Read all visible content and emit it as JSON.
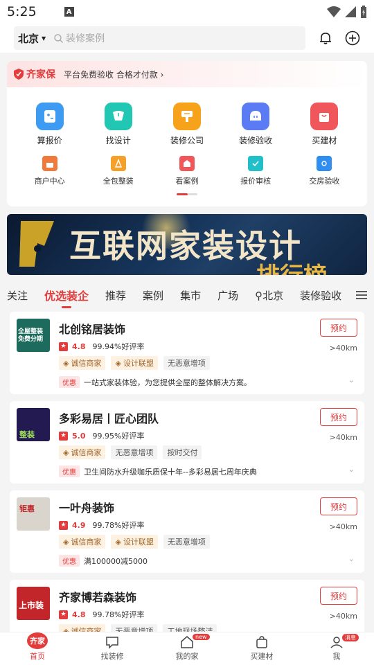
{
  "status": {
    "time": "5:25",
    "a_icon": "A"
  },
  "search": {
    "city": "北京",
    "placeholder": "装修案例"
  },
  "guarantee": {
    "brand": "齐家保",
    "text": "平台免费验收 合格才付款 ›"
  },
  "quick_big": [
    {
      "label": "算报价",
      "icon": "calculator-icon",
      "color": "#3d9bf2"
    },
    {
      "label": "找设计",
      "icon": "design-icon",
      "color": "#22c7b4"
    },
    {
      "label": "装修公司",
      "icon": "company-icon",
      "color": "#f7a21b"
    },
    {
      "label": "装修验收",
      "icon": "inspect-icon",
      "color": "#5a7bf4"
    },
    {
      "label": "买建材",
      "icon": "cart-icon",
      "color": "#f0575b"
    }
  ],
  "quick_small": [
    {
      "label": "商户中心",
      "icon": "shop-icon",
      "color": "#f07a3c"
    },
    {
      "label": "全包整装",
      "icon": "package-icon",
      "color": "#f5a02a"
    },
    {
      "label": "看案例",
      "icon": "case-icon",
      "color": "#f0575b"
    },
    {
      "label": "报价审核",
      "icon": "audit-icon",
      "color": "#21c0c8"
    },
    {
      "label": "交房验收",
      "icon": "handover-icon",
      "color": "#2f8ef0"
    }
  ],
  "banner": {
    "title": "互联网家装设计",
    "sub": "排行榜"
  },
  "tabs": [
    "关注",
    "优选装企",
    "推荐",
    "案例",
    "集市",
    "广场",
    "北京",
    "装修验收"
  ],
  "shops": [
    {
      "name": "北创铭居装饰",
      "score": "4.8",
      "good": "99.94%好评率",
      "tags": [
        {
          "t": "诚信商家",
          "k": "gold"
        },
        {
          "t": "设计联盟",
          "k": "gold"
        },
        {
          "t": "无恶意增项",
          "k": "gray"
        }
      ],
      "promo": "一站式家装体验，为您提供全屋的整体解决方案。",
      "book": "预约",
      "dist": ">40km",
      "thumb_text": "全屋整装\n免费分期",
      "thumb_bg": "#1d6b5c"
    },
    {
      "name": "多彩易居丨匠心团队",
      "score": "5.0",
      "good": "99.95%好评率",
      "tags": [
        {
          "t": "诚信商家",
          "k": "gold"
        },
        {
          "t": "无恶意增项",
          "k": "gray"
        },
        {
          "t": "按时交付",
          "k": "gray"
        }
      ],
      "promo": "卫生间防水升级咖乐质保十年--多彩易居七周年庆典",
      "book": "预约",
      "dist": ">40km",
      "thumb_text": "整装",
      "thumb_bg": "#241a52"
    },
    {
      "name": "一叶舟装饰",
      "score": "4.9",
      "good": "99.78%好评率",
      "tags": [
        {
          "t": "诚信商家",
          "k": "gold"
        },
        {
          "t": "设计联盟",
          "k": "gold"
        },
        {
          "t": "无恶意增项",
          "k": "gray"
        }
      ],
      "promo": "满100000减5000",
      "book": "预约",
      "dist": ">40km",
      "thumb_text": "钜惠",
      "thumb_bg": "#d9d4cc"
    },
    {
      "name": "齐家博若森装饰",
      "score": "4.8",
      "good": "99.78%好评率",
      "tags": [
        {
          "t": "诚信商家",
          "k": "gold"
        },
        {
          "t": "无恶意增项",
          "k": "gray"
        },
        {
          "t": "工地现场整洁",
          "k": "gray"
        }
      ],
      "promo": "",
      "book": "预约",
      "dist": ">40km",
      "thumb_text": "上市装",
      "thumb_bg": "#c2262a"
    }
  ],
  "nav": [
    {
      "label": "首页",
      "badge": "齐家"
    },
    {
      "label": "找装修"
    },
    {
      "label": "我的家",
      "new": "new"
    },
    {
      "label": "买建材"
    },
    {
      "label": "我",
      "new": "消息"
    }
  ],
  "promo_label": "优惠"
}
